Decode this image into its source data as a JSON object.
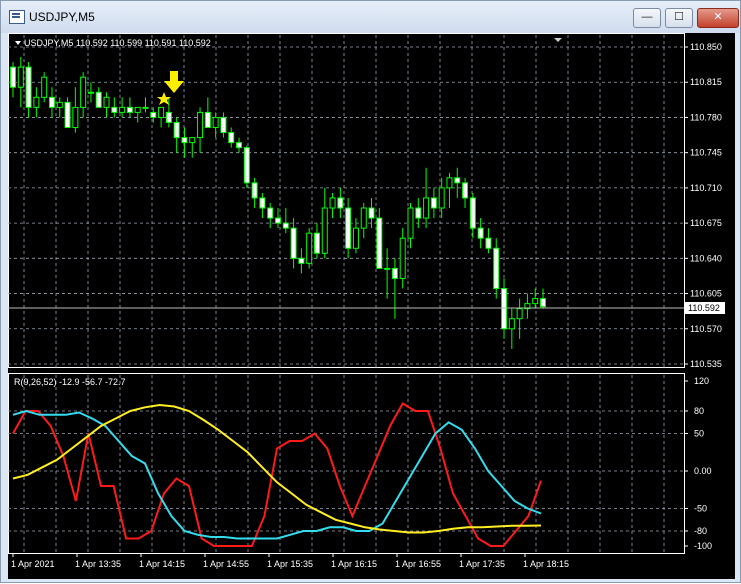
{
  "window": {
    "title": "USDJPY,M5",
    "minimize_glyph": "—",
    "maximize_glyph": "☐",
    "close_glyph": "✕",
    "icon": "chart-window-icon"
  },
  "main_pane": {
    "header": "USDJPY,M5  110.592 110.599 110.591 110.592",
    "price_axis_labels": [
      "110.850",
      "110.815",
      "110.780",
      "110.745",
      "110.710",
      "110.675",
      "110.640",
      "110.605",
      "110.570",
      "110.535"
    ],
    "current_price": "110.592",
    "signal_marker": "arrow-down-and-star"
  },
  "indicator_pane": {
    "header": "R(9,26,52) -12.9 -56.7 -72.7",
    "axis_labels": [
      "120",
      "80",
      "50",
      "0.00",
      "-50",
      "-80",
      "-100"
    ]
  },
  "time_axis_labels": [
    "1 Apr 2021",
    "1 Apr 13:35",
    "1 Apr 14:15",
    "1 Apr 14:55",
    "1 Apr 15:35",
    "1 Apr 16:15",
    "1 Apr 16:55",
    "1 Apr 17:35",
    "1 Apr 18:15"
  ],
  "colors": {
    "background": "#000000",
    "grid": "#9aa6b2",
    "bull_candle": "#00ff00",
    "bear_candle": "#ffffff",
    "series_red": "#ff1a1a",
    "series_cyan": "#33ddee",
    "series_yellow": "#ffee22",
    "signal": "#ffee00"
  },
  "chart_data": [
    {
      "type": "candlestick",
      "symbol": "USDJPY",
      "timeframe": "M5",
      "ylim": [
        110.535,
        110.85
      ],
      "last_price": 110.592,
      "candles": [
        [
          110.83,
          110.835,
          110.8,
          110.81
        ],
        [
          110.81,
          110.84,
          110.79,
          110.83
        ],
        [
          110.83,
          110.835,
          110.78,
          110.79
        ],
        [
          110.79,
          110.81,
          110.78,
          110.8
        ],
        [
          110.8,
          110.825,
          110.795,
          110.82
        ],
        [
          110.8,
          110.81,
          110.78,
          110.79
        ],
        [
          110.79,
          110.8,
          110.78,
          110.795
        ],
        [
          110.795,
          110.8,
          110.77,
          110.77
        ],
        [
          110.77,
          110.81,
          110.765,
          110.79
        ],
        [
          110.79,
          110.825,
          110.78,
          110.82
        ],
        [
          110.805,
          110.815,
          110.795,
          110.805
        ],
        [
          110.805,
          110.81,
          110.79,
          110.79
        ],
        [
          110.79,
          110.805,
          110.78,
          110.8
        ],
        [
          110.79,
          110.8,
          110.78,
          110.785
        ],
        [
          110.785,
          110.8,
          110.78,
          110.79
        ],
        [
          110.79,
          110.8,
          110.78,
          110.785
        ],
        [
          110.785,
          110.79,
          110.775,
          110.79
        ],
        [
          110.79,
          110.8,
          110.785,
          110.79
        ],
        [
          110.785,
          110.79,
          110.775,
          110.78
        ],
        [
          110.78,
          110.79,
          110.77,
          110.79
        ],
        [
          110.785,
          110.8,
          110.77,
          110.775
        ],
        [
          110.775,
          110.78,
          110.745,
          110.76
        ],
        [
          110.76,
          110.77,
          110.74,
          110.755
        ],
        [
          110.755,
          110.76,
          110.74,
          110.76
        ],
        [
          110.76,
          110.79,
          110.745,
          110.785
        ],
        [
          110.785,
          110.8,
          110.77,
          110.77
        ],
        [
          110.77,
          110.785,
          110.76,
          110.78
        ],
        [
          110.78,
          110.785,
          110.76,
          110.765
        ],
        [
          110.765,
          110.77,
          110.75,
          110.755
        ],
        [
          110.755,
          110.76,
          110.745,
          110.75
        ],
        [
          110.75,
          110.752,
          110.71,
          110.715
        ],
        [
          110.715,
          110.72,
          110.69,
          110.7
        ],
        [
          110.7,
          110.705,
          110.68,
          110.69
        ],
        [
          110.69,
          110.695,
          110.67,
          110.68
        ],
        [
          110.68,
          110.69,
          110.67,
          110.675
        ],
        [
          110.675,
          110.69,
          110.665,
          110.67
        ],
        [
          110.67,
          110.68,
          110.63,
          110.64
        ],
        [
          110.64,
          110.65,
          110.625,
          110.635
        ],
        [
          110.635,
          110.67,
          110.63,
          110.665
        ],
        [
          110.665,
          110.675,
          110.64,
          110.645
        ],
        [
          110.645,
          110.71,
          110.64,
          110.69
        ],
        [
          110.69,
          110.705,
          110.68,
          110.7
        ],
        [
          110.7,
          110.71,
          110.68,
          110.69
        ],
        [
          110.69,
          110.7,
          110.64,
          110.65
        ],
        [
          110.65,
          110.68,
          110.645,
          110.67
        ],
        [
          110.67,
          110.695,
          110.66,
          110.69
        ],
        [
          110.69,
          110.7,
          110.67,
          110.68
        ],
        [
          110.68,
          110.69,
          110.64,
          110.63
        ],
        [
          110.63,
          110.65,
          110.6,
          110.63
        ],
        [
          110.63,
          110.64,
          110.58,
          110.62
        ],
        [
          110.62,
          110.67,
          110.61,
          110.66
        ],
        [
          110.66,
          110.695,
          110.65,
          110.69
        ],
        [
          110.69,
          110.7,
          110.67,
          110.68
        ],
        [
          110.68,
          110.73,
          110.67,
          110.7
        ],
        [
          110.7,
          110.71,
          110.68,
          110.69
        ],
        [
          110.69,
          110.72,
          110.68,
          110.71
        ],
        [
          110.71,
          110.725,
          110.69,
          110.72
        ],
        [
          110.72,
          110.73,
          110.7,
          110.715
        ],
        [
          110.715,
          110.72,
          110.69,
          110.7
        ],
        [
          110.7,
          110.705,
          110.66,
          110.67
        ],
        [
          110.67,
          110.68,
          110.65,
          110.66
        ],
        [
          110.66,
          110.67,
          110.645,
          110.65
        ],
        [
          110.65,
          110.66,
          110.6,
          110.61
        ],
        [
          110.61,
          110.62,
          110.56,
          110.57
        ],
        [
          110.57,
          110.59,
          110.55,
          110.58
        ],
        [
          110.58,
          110.6,
          110.56,
          110.59
        ],
        [
          110.59,
          110.605,
          110.58,
          110.595
        ],
        [
          110.595,
          110.61,
          110.59,
          110.6
        ],
        [
          110.6,
          110.61,
          110.59,
          110.592
        ]
      ],
      "signal_index": 24
    },
    {
      "type": "line",
      "title": "R(9,26,52)",
      "ylim": [
        -100,
        120
      ],
      "last_values": [
        -12.9,
        -56.7,
        -72.7
      ],
      "series": [
        {
          "color": "red",
          "values": [
            50,
            80,
            80,
            60,
            20,
            -40,
            50,
            -20,
            -20,
            -90,
            -90,
            -80,
            -30,
            -10,
            -20,
            -90,
            -100,
            -100,
            -100,
            -100,
            -60,
            30,
            40,
            40,
            50,
            30,
            -20,
            -60,
            -20,
            20,
            60,
            90,
            80,
            80,
            30,
            -30,
            -60,
            -90,
            -100,
            -100,
            -80,
            -60,
            -12.9
          ]
        },
        {
          "color": "cyan",
          "values": [
            75,
            80,
            75,
            75,
            75,
            78,
            70,
            60,
            40,
            20,
            10,
            -30,
            -60,
            -80,
            -85,
            -88,
            -88,
            -90,
            -90,
            -90,
            -90,
            -85,
            -80,
            -80,
            -75,
            -75,
            -80,
            -80,
            -70,
            -40,
            -10,
            20,
            50,
            65,
            55,
            30,
            0,
            -20,
            -40,
            -50,
            -56.7
          ]
        },
        {
          "color": "yellow",
          "values": [
            -10,
            -5,
            5,
            15,
            30,
            45,
            60,
            70,
            80,
            85,
            88,
            86,
            80,
            68,
            55,
            40,
            25,
            5,
            -15,
            -30,
            -45,
            -55,
            -65,
            -70,
            -75,
            -78,
            -80,
            -82,
            -82,
            -80,
            -77,
            -75,
            -75,
            -74,
            -73,
            -73,
            -72.7
          ]
        }
      ]
    }
  ]
}
